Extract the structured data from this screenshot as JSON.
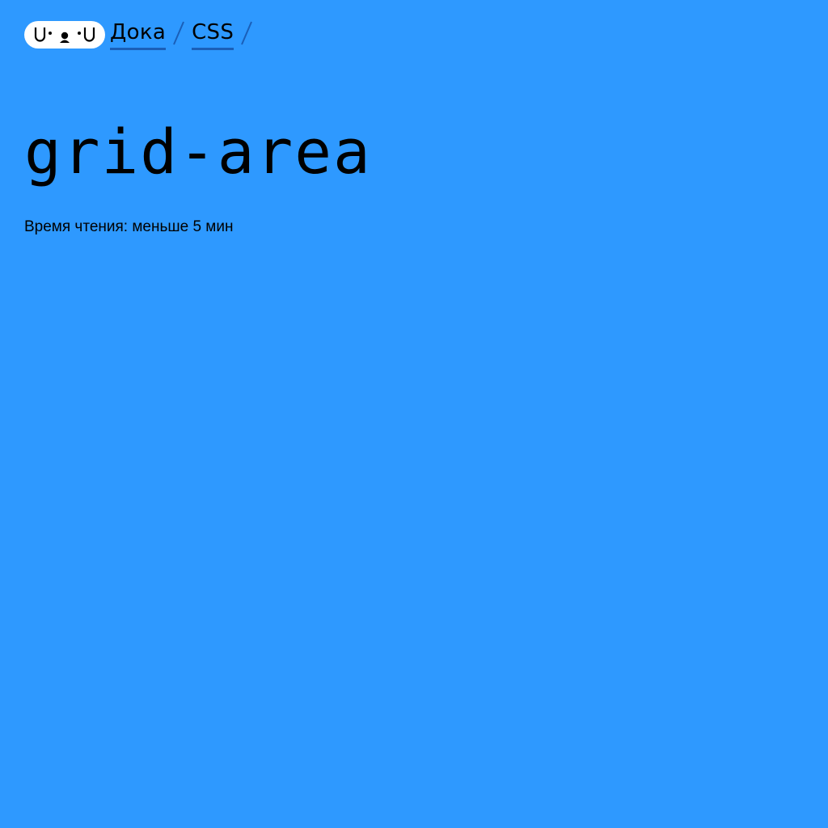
{
  "header": {
    "logo_icon": "doka-face-logo-icon",
    "breadcrumbs": [
      {
        "label": "Дока"
      },
      {
        "label": "CSS"
      }
    ],
    "separator_icon": "slash-separator-icon"
  },
  "page": {
    "title": "grid-area",
    "reading_time": "Время чтения: меньше 5 мин"
  },
  "colors": {
    "background": "#2e99ff",
    "text": "#000000",
    "logo_background": "#ffffff",
    "link_underline": "#1a5fb8",
    "separator": "#1a5fb8"
  }
}
